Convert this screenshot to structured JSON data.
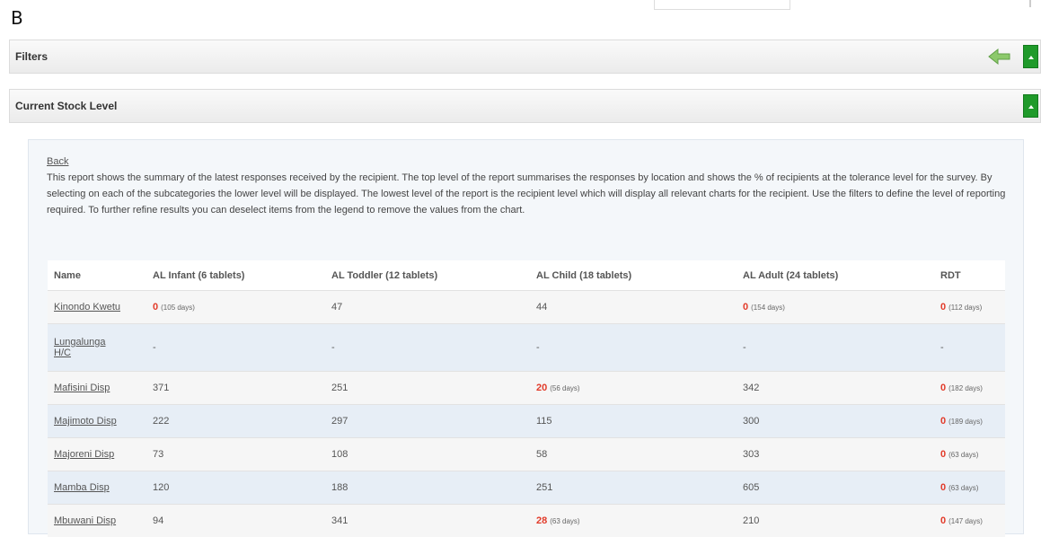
{
  "figure_label": "B",
  "filters_panel": {
    "title": "Filters"
  },
  "stock_panel": {
    "title": "Current Stock Level"
  },
  "report": {
    "back_label": "Back",
    "description": "This report shows the summary of the latest responses received by the recipient. The top level of the report summarises the responses by location and shows the % of recipients at the tolerance level for the survey. By selecting on each of the subcategories the lower level will be displayed. The lowest level of the report is the recipient level which will display all relevant charts for the recipient. Use the filters to define the level of reporting required. To further refine results you can deselect items from the legend to remove the values from the chart."
  },
  "table": {
    "headers": [
      "Name",
      "AL Infant (6 tablets)",
      "AL Toddler (12 tablets)",
      "AL Child (18 tablets)",
      "AL Adult (24 tablets)",
      "RDT"
    ],
    "rows": [
      {
        "name": "Kinondo Kwetu",
        "cells": [
          {
            "value": "0",
            "days": "(105 days)",
            "alert": true
          },
          {
            "value": "47",
            "days": "",
            "alert": false
          },
          {
            "value": "44",
            "days": "",
            "alert": false
          },
          {
            "value": "0",
            "days": "(154 days)",
            "alert": true
          },
          {
            "value": "0",
            "days": "(112 days)",
            "alert": true
          }
        ]
      },
      {
        "name": "Lungalunga H/C",
        "cells": [
          {
            "value": "-",
            "days": "",
            "alert": false
          },
          {
            "value": "-",
            "days": "",
            "alert": false
          },
          {
            "value": "-",
            "days": "",
            "alert": false
          },
          {
            "value": "-",
            "days": "",
            "alert": false
          },
          {
            "value": "-",
            "days": "",
            "alert": false
          }
        ]
      },
      {
        "name": "Mafisini Disp",
        "cells": [
          {
            "value": "371",
            "days": "",
            "alert": false
          },
          {
            "value": "251",
            "days": "",
            "alert": false
          },
          {
            "value": "20",
            "days": "(56 days)",
            "alert": true
          },
          {
            "value": "342",
            "days": "",
            "alert": false
          },
          {
            "value": "0",
            "days": "(182 days)",
            "alert": true
          }
        ]
      },
      {
        "name": "Majimoto Disp",
        "cells": [
          {
            "value": "222",
            "days": "",
            "alert": false
          },
          {
            "value": "297",
            "days": "",
            "alert": false
          },
          {
            "value": "115",
            "days": "",
            "alert": false
          },
          {
            "value": "300",
            "days": "",
            "alert": false
          },
          {
            "value": "0",
            "days": "(189 days)",
            "alert": true
          }
        ]
      },
      {
        "name": "Majoreni Disp",
        "cells": [
          {
            "value": "73",
            "days": "",
            "alert": false
          },
          {
            "value": "108",
            "days": "",
            "alert": false
          },
          {
            "value": "58",
            "days": "",
            "alert": false
          },
          {
            "value": "303",
            "days": "",
            "alert": false
          },
          {
            "value": "0",
            "days": "(63 days)",
            "alert": true
          }
        ]
      },
      {
        "name": "Mamba Disp",
        "cells": [
          {
            "value": "120",
            "days": "",
            "alert": false
          },
          {
            "value": "188",
            "days": "",
            "alert": false
          },
          {
            "value": "251",
            "days": "",
            "alert": false
          },
          {
            "value": "605",
            "days": "",
            "alert": false
          },
          {
            "value": "0",
            "days": "(63 days)",
            "alert": true
          }
        ]
      },
      {
        "name": "Mbuwani Disp",
        "cells": [
          {
            "value": "94",
            "days": "",
            "alert": false
          },
          {
            "value": "341",
            "days": "",
            "alert": false
          },
          {
            "value": "28",
            "days": "(63 days)",
            "alert": true
          },
          {
            "value": "210",
            "days": "",
            "alert": false
          },
          {
            "value": "0",
            "days": "(147 days)",
            "alert": true
          }
        ]
      }
    ]
  },
  "icons": {
    "back_arrow": "left-arrow-icon",
    "toggle": "caret-up-icon"
  },
  "colors": {
    "toggle_green": "#1f9a2a",
    "alert_red": "#e23b2a",
    "row_alt": "#e7eef6"
  }
}
